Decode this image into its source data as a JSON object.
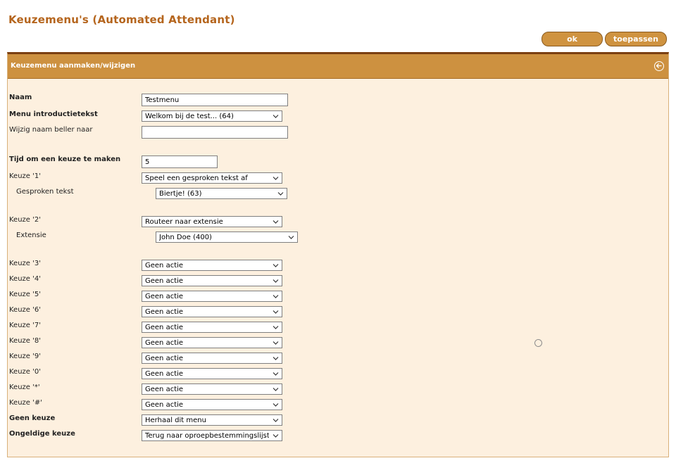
{
  "page": {
    "title": "Keuzemenu's (Automated Attendant)",
    "buttons": {
      "ok": "ok",
      "apply": "toepassen"
    }
  },
  "panel": {
    "title": "Keuzemenu aanmaken/wijzigen",
    "fields": {
      "naam": {
        "label": "Naam",
        "value": "Testmenu"
      },
      "intro": {
        "label": "Menu introductietekst",
        "value": "Welkom bij de test... (64)"
      },
      "rename": {
        "label": "Wijzig naam beller naar",
        "value": ""
      },
      "timeout": {
        "label": "Tijd om een keuze te maken",
        "value": "5"
      },
      "keuze1": {
        "label": "Keuze '1'",
        "value": "Speel een gesproken tekst af"
      },
      "spoken": {
        "label": "Gesproken tekst",
        "value": "Biertje! (63)"
      },
      "keuze2": {
        "label": "Keuze '2'",
        "value": "Routeer naar extensie"
      },
      "extension": {
        "label": "Extensie",
        "value": "John Doe (400)"
      },
      "keuze3": {
        "label": "Keuze '3'",
        "value": "Geen actie"
      },
      "keuze4": {
        "label": "Keuze '4'",
        "value": "Geen actie"
      },
      "keuze5": {
        "label": "Keuze '5'",
        "value": "Geen actie"
      },
      "keuze6": {
        "label": "Keuze '6'",
        "value": "Geen actie"
      },
      "keuze7": {
        "label": "Keuze '7'",
        "value": "Geen actie"
      },
      "keuze8": {
        "label": "Keuze '8'",
        "value": "Geen actie"
      },
      "keuze9": {
        "label": "Keuze '9'",
        "value": "Geen actie"
      },
      "keuze0": {
        "label": "Keuze '0'",
        "value": "Geen actie"
      },
      "keuzeStar": {
        "label": "Keuze '*'",
        "value": "Geen actie"
      },
      "keuzeHash": {
        "label": "Keuze '#'",
        "value": "Geen actie"
      },
      "noChoice": {
        "label": "Geen keuze",
        "value": "Herhaal dit menu"
      },
      "invalid": {
        "label": "Ongeldige keuze",
        "value": "Terug naar oproepbestemmingslijst ("
      }
    }
  },
  "icons": {
    "back": "back-arrow-icon",
    "dropdown": "chevron-down-icon"
  },
  "colors": {
    "title": "#b5651d",
    "header": "#cd9140",
    "panelBackground": "#fdf0df",
    "button": "#cf9340"
  }
}
